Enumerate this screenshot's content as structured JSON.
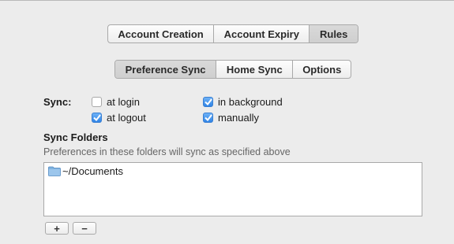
{
  "top_tabs": [
    "Account Creation",
    "Account Expiry",
    "Rules"
  ],
  "top_tabs_selected": "Rules",
  "sub_tabs": [
    "Preference Sync",
    "Home Sync",
    "Options"
  ],
  "sub_tabs_selected": "Preference Sync",
  "sync": {
    "label": "Sync:",
    "options": [
      {
        "label": "at login",
        "checked": false
      },
      {
        "label": "in background",
        "checked": true
      },
      {
        "label": "at logout",
        "checked": true
      },
      {
        "label": "manually",
        "checked": true
      }
    ]
  },
  "sync_folders": {
    "title": "Sync Folders",
    "description": "Preferences in these folders will sync as specified above",
    "items": [
      "~/Documents"
    ]
  },
  "buttons": {
    "add": "+",
    "remove": "−"
  },
  "colors": {
    "checkbox_on": "#2f84e6",
    "selected_segment": "#d3d3d3"
  }
}
